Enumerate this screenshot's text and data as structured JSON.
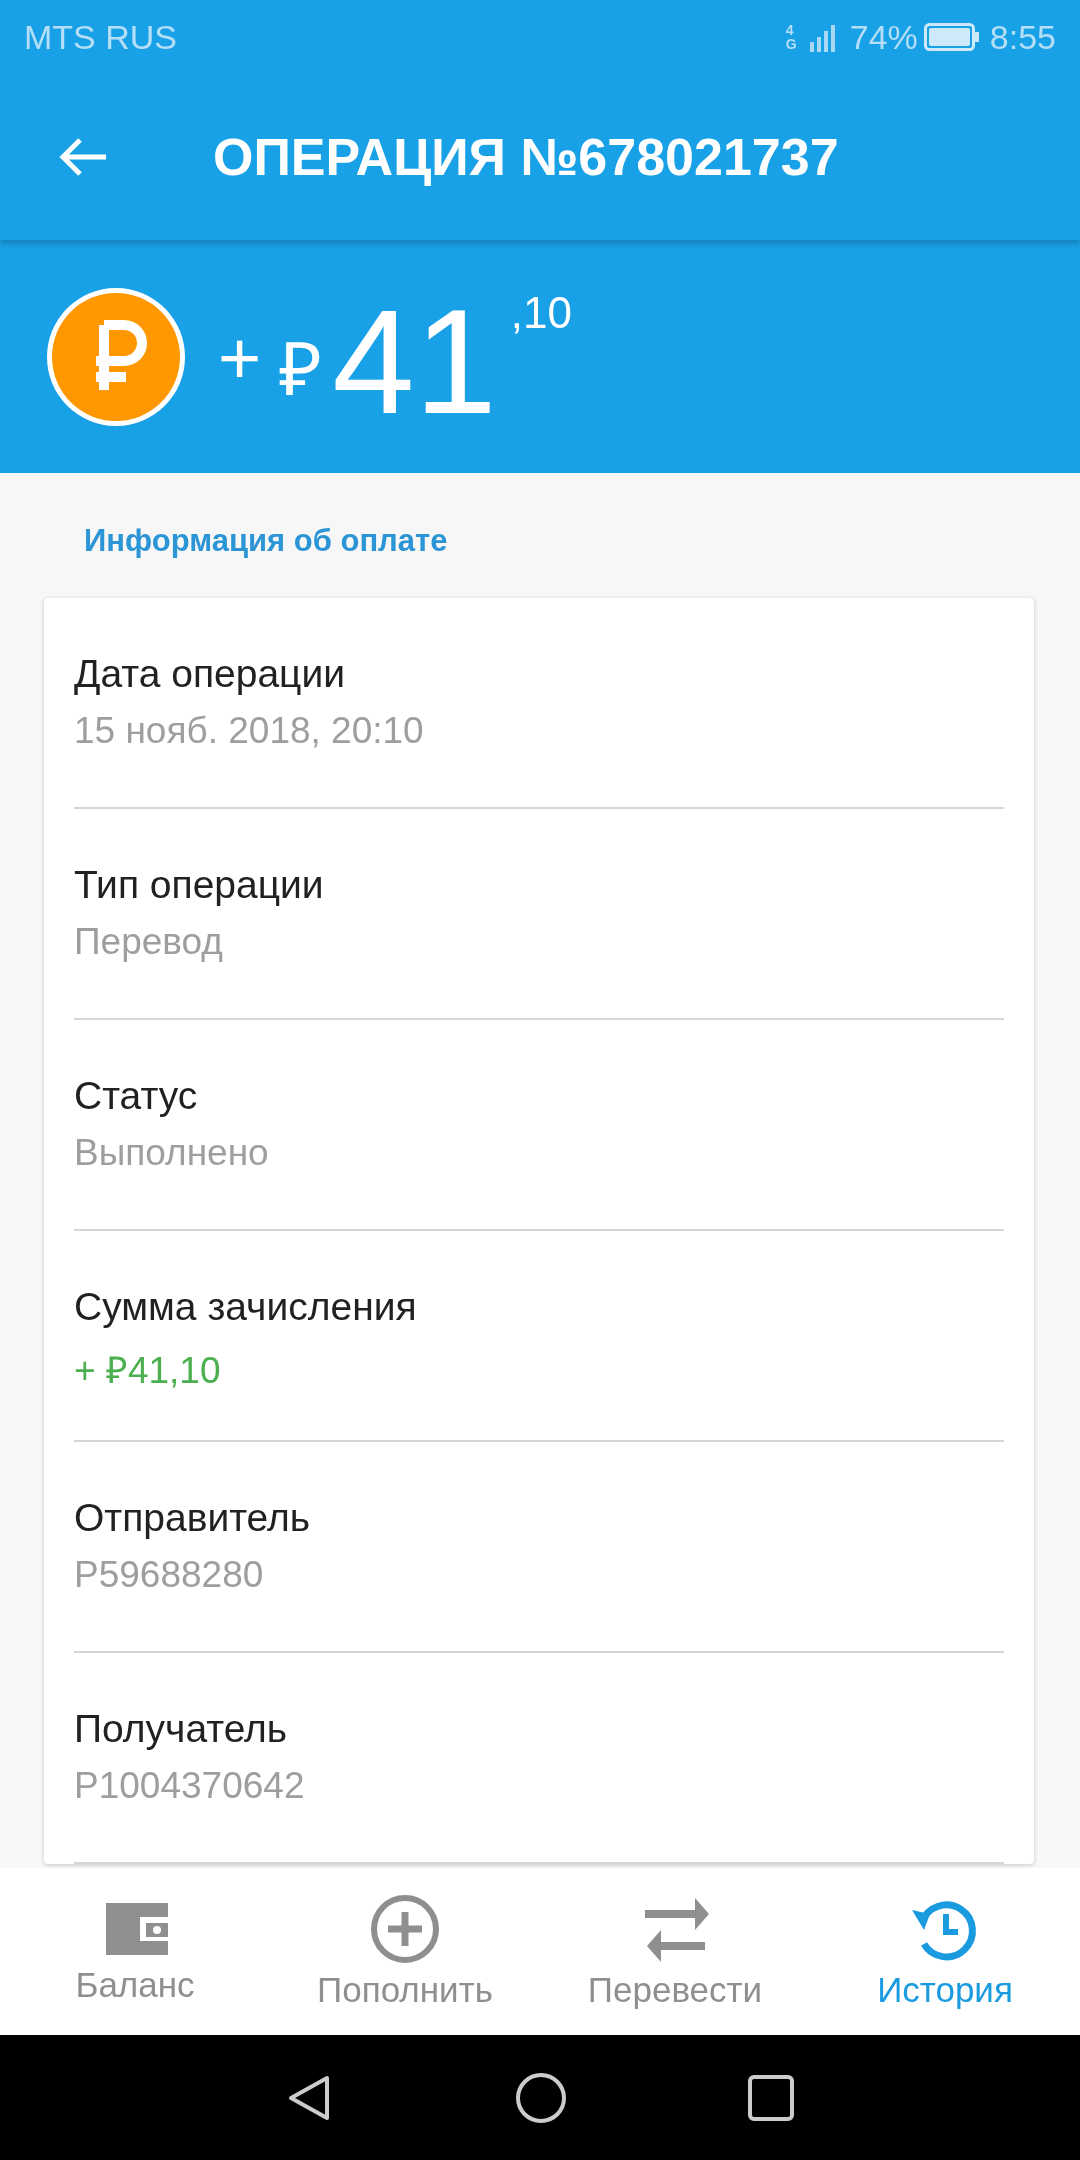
{
  "status_bar": {
    "carrier": "MTS RUS",
    "network": "4G",
    "battery": "74%",
    "time": "8:55"
  },
  "app_bar": {
    "title": "ОПЕРАЦИЯ №678021737"
  },
  "amount": {
    "sign": "+",
    "currency": "₽",
    "integer": "41",
    "fraction": ",10"
  },
  "section_title": "Информация об оплате",
  "details": [
    {
      "label": "Дата операции",
      "value": "15 нояб. 2018, 20:10",
      "kind": "plain"
    },
    {
      "label": "Тип операции",
      "value": "Перевод",
      "kind": "plain"
    },
    {
      "label": "Статус",
      "value": "Выполнено",
      "kind": "plain"
    },
    {
      "label": "Сумма зачисления",
      "value": "+ ₽41,10",
      "kind": "credit"
    },
    {
      "label": "Отправитель",
      "value": "P59688280",
      "kind": "plain"
    },
    {
      "label": "Получатель",
      "value": "P1004370642",
      "kind": "plain"
    }
  ],
  "bottom_nav": [
    {
      "label": "Баланс",
      "kind": "wallet",
      "selected": false
    },
    {
      "label": "Пополнить",
      "kind": "plus",
      "selected": false
    },
    {
      "label": "Перевести",
      "kind": "transfer",
      "selected": false
    },
    {
      "label": "История",
      "kind": "history",
      "selected": true
    }
  ]
}
